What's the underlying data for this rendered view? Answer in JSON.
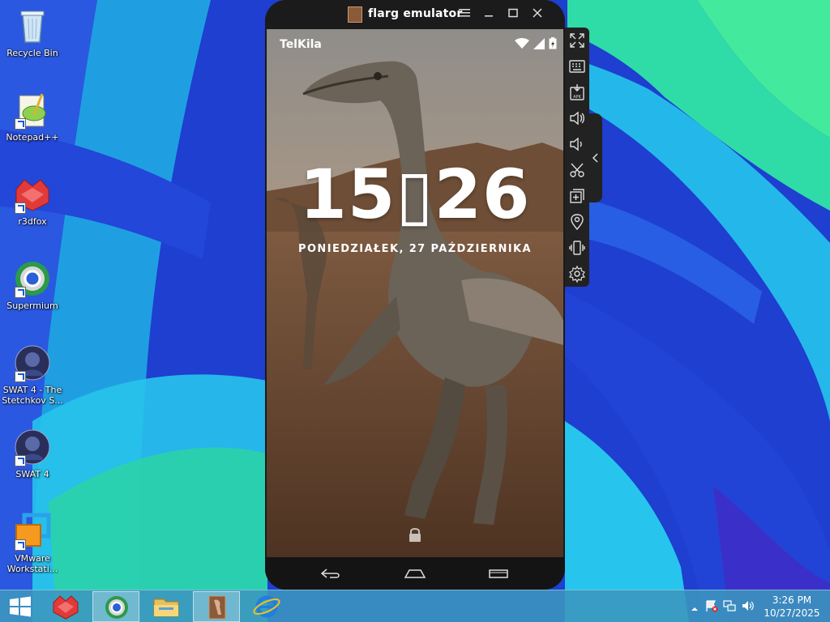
{
  "desktop": {
    "icons": [
      {
        "label": "Recycle Bin"
      },
      {
        "label": "Notepad++"
      },
      {
        "label": "r3dfox"
      },
      {
        "label": "Supermium"
      },
      {
        "label": "SWAT 4 - The Stetchkov S..."
      },
      {
        "label": "SWAT 4"
      },
      {
        "label": "VMware Workstati..."
      }
    ]
  },
  "emulator": {
    "title": "flarg emulator",
    "window_buttons": [
      "menu-icon",
      "minimize-icon",
      "maximize-icon",
      "close-icon"
    ],
    "status_bar": {
      "carrier": "TelKila",
      "icons": [
        "wifi-icon",
        "signal-icon",
        "battery-icon"
      ]
    },
    "lockscreen": {
      "time": "15▯26",
      "date": "PONIEDZIAŁEK, 27 PAŹDZIERNIKA"
    },
    "nav": [
      "back-icon",
      "home-icon",
      "recents-icon"
    ],
    "toolbar": [
      "fullscreen-icon",
      "keyboard-icon",
      "apk-install-icon",
      "volume-up-icon",
      "volume-down-icon",
      "scissors-icon",
      "add-window-icon",
      "location-icon",
      "shake-icon",
      "settings-icon"
    ]
  },
  "taskbar": {
    "items": [
      "start-button",
      "r3dfox-icon",
      "supermium-icon",
      "file-explorer-icon",
      "flarg-emulator-icon",
      "internet-explorer-icon"
    ],
    "tray": {
      "time": "3:26 PM",
      "date": "10/27/2025"
    }
  },
  "colors": {
    "wallpaper_blue": "#1f3fd0",
    "wallpaper_cyan": "#25b6e8",
    "wallpaper_green": "#3fe8a8",
    "taskbar": "#3c96be"
  }
}
